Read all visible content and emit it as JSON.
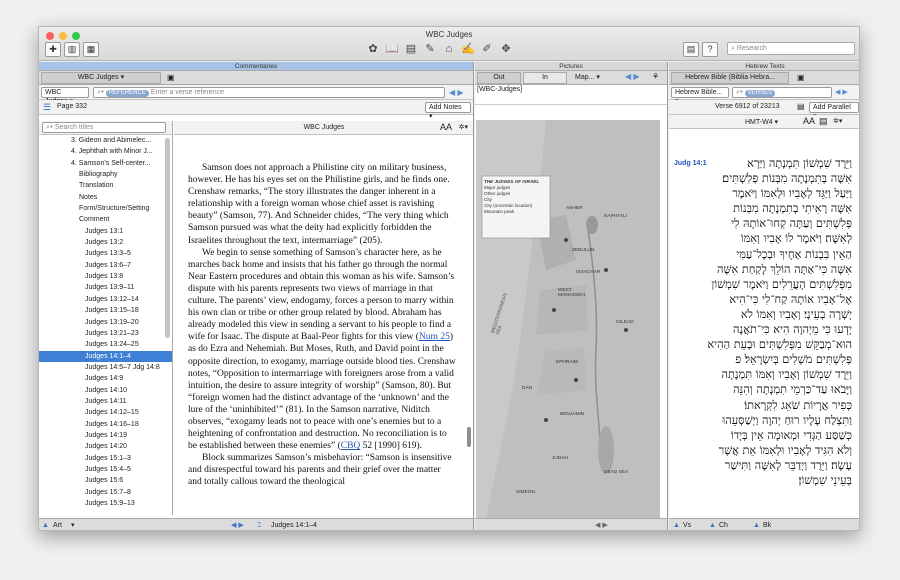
{
  "window": {
    "title": "WBC Judges"
  },
  "toolbar": {
    "search_placeholder": "Research"
  },
  "commentaries": {
    "header": "Commentaries",
    "tab": "WBC Judges",
    "book": "WBC Judges",
    "reference_pill": "REFERENCE",
    "verse_placeholder": "Enter a verse reference",
    "page": "Page 332",
    "add_notes": "Add Notes",
    "search_titles": "Search titles",
    "content_title": "WBC Judges",
    "tree": [
      "3. Gideon and Abimelec...",
      "4. Jephthah with Minor J...",
      "4. Samson's Self-center...",
      "Bibliography",
      "Translation",
      "Notes",
      "Form/Structure/Setting",
      "Comment",
      "Judges 13:1",
      "Judges 13:2",
      "Judges 13:3–5",
      "Judges 13:6–7",
      "Judges 13:8",
      "Judges 13:9–11",
      "Judges 13:12–14",
      "Judges 13:15–18",
      "Judges 13:19–20",
      "Judges 13:21–23",
      "Judges 13:24–25",
      "Judges 14:1–4",
      "Judges 14:5–7 Jdg 14:8",
      "Judges 14:9",
      "Judges 14:10",
      "Judges 14:11",
      "Judges 14:12–15",
      "Judges 14:16–18",
      "Judges 14:19",
      "Judges 14:20",
      "Judges 15:1–3",
      "Judges 15:4–5",
      "Judges 15:6",
      "Judges 15:7–8",
      "Judges 15:9–13"
    ],
    "para1": "Samson does not approach a Philistine city on military business, however. He has his eyes set on the Philistine girls, and he finds one. Crenshaw remarks, “The story illustrates the danger inherent in a relationship with a foreign woman whose chief asset is ravishing beauty” (Samson, 77). And Schneider chides, “The very thing which Samson pursued was what the deity had explicitly forbidden the Israelites throughout the text, intermarriage” (205).",
    "para2a": "We begin to sense something of Samson’s character here, as he marches back home and insists that his father go through the normal Near Eastern procedures and obtain this woman as his wife. Samson’s dispute with his parents represents two views of marriage in that culture. The parents’ view, endogamy, forces a person to marry within his own clan or tribe or other group related by blood. Abraham has already modeled this view in sending a servant to his people to find a wife for Isaac. The dispute at Baal-Peor fights for this view (",
    "link1": "Num 25",
    "para2b": ") as do Ezra and Nehemiah. But Moses, Ruth, and David point in the opposite direction, to exogamy, marriage outside blood ties. Crenshaw notes, “Opposition to intermarriage with foreigners arose from a valid intuition, the desire to assure integrity of worship” (Samson, 80). But “foreign women had the distinct advantage of the ‘unknown’ and the lure of the ‘uninhibited’” (81). In the Samson narrative, Niditch observes, “exogamy leads not to peace with one’s enemies but to a heightening of confrontation and destruction. No reconciliation is to be established between these enemies” (",
    "link2": "CBQ",
    "para2c": " 52 [1990] 619).",
    "para3": "Block summarizes Samson’s misbehavior: “Samson is insensitive and disrespectful toward his parents and their grief over the matter and totally callous toward the theological",
    "footer_left": "Art",
    "footer_ref": "Judges 14:1–4"
  },
  "pictures": {
    "header": "Pictures",
    "tab_out": "Out",
    "tab_in": "In",
    "popup": "Map...",
    "caption": "[WBC-Judges]",
    "legend_title": "THE JUDGES OF ISRAEL",
    "legend": [
      "Major judges",
      "Other judges",
      "City",
      "City (uncertain location)",
      "Mountain peak"
    ],
    "regions": [
      "ASHER",
      "NAPHTALI",
      "ZEBULUN",
      "ISSACHAR",
      "WEST MANASSEH",
      "EPHRAIM",
      "BENJAMIN",
      "JUDAH",
      "DAN",
      "GILEAD",
      "SIMEON",
      "MEDITERRANEAN SEA",
      "DEAD SEA"
    ]
  },
  "hebrew": {
    "header": "Hebrew Texts",
    "tab": "Hebrew Bible (Biblia Hebra...",
    "book": "Hebrew Bible...",
    "verses_pill": "VERSES",
    "verse_info": "Verse 6912 of 23213",
    "add_parallel": "Add Parallel",
    "version": "HMT-W4",
    "ref": "Judg 14:1",
    "lines": [
      "וַיֵּרֶד שִׁמְשׁוֹן תִּמְנָתָה וַיַּרְא",
      "אִשָּׁה בְּתִמְנָתָה מִבְּנוֹת פְּלִשְׁתִּים׃",
      "וַיַּעַל וַיַּגֵּד לְאָבִיו וּלְאִמּוֹ וַיֹּאמֶר",
      "אִשָּׁה רָאִיתִי בְתִמְנָתָה מִבְּנוֹת",
      "פְּלִשְׁתִּים וְעַתָּה קְחוּ־אוֹתָהּ לִי",
      "לְאִשָּׁה׃ וַיֹּאמֶר לוֹ אָבִיו וְאִמּוֹ",
      "הַאֵין בִּבְנוֹת אַחֶיךָ וּבְכָל־עַמִּי",
      "אִשָּׁה כִּי־אַתָּה הוֹלֵךְ לָקַחַת אִשָּׁה",
      "מִפְּלִשְׁתִּים הָעֲרֵלִים וַיֹּאמֶר שִׁמְשׁוֹן",
      "אֶל־אָבִיו אוֹתָהּ קַח־לִי כִּי־הִיא",
      "יָשְׁרָה בְעֵינָי׃ וְאָבִיו וְאִמּוֹ לֹא",
      "יָדְעוּ כִּי מֵיְהוָה הִיא כִּי־תֹאֲנָה",
      "הוּא־מְבַקֵּשׁ מִפְּלִשְׁתִּים וּבָעֵת הַהִיא",
      "פְּלִשְׁתִּים מֹשְׁלִים בְּיִשְׂרָאֵל׃ פ",
      "וַיֵּרֶד שִׁמְשׁוֹן וְאָבִיו וְאִמּוֹ תִּמְנָתָה",
      "וַיָּבֹאוּ עַד־כַּרְמֵי תִמְנָתָה וְהִנֵּה",
      "כְּפִיר אֲרָיוֹת שֹׁאֵג לִקְרָאתוֹ׃",
      "וַתִּצְלַח עָלָיו רוּחַ יְהוָה וַיְשַׁסְּעֵהוּ",
      "כְּשַׁסַּע הַגְּדִי וּמְאוּמָה אֵין בְּיָדוֹ",
      "וְלֹא הִגִּיד לְאָבִיו וּלְאִמּוֹ אֵת אֲשֶׁר",
      "עָשָׂה׃ וַיֵּרֶד וַיְדַבֵּר לָאִשָּׁה וַתִּישַׁר",
      "בְּעֵינֵי שִׁמְשׁוֹן׃"
    ],
    "footer_vs": "Vs",
    "footer_ch": "Ch",
    "footer_bk": "Bk"
  }
}
